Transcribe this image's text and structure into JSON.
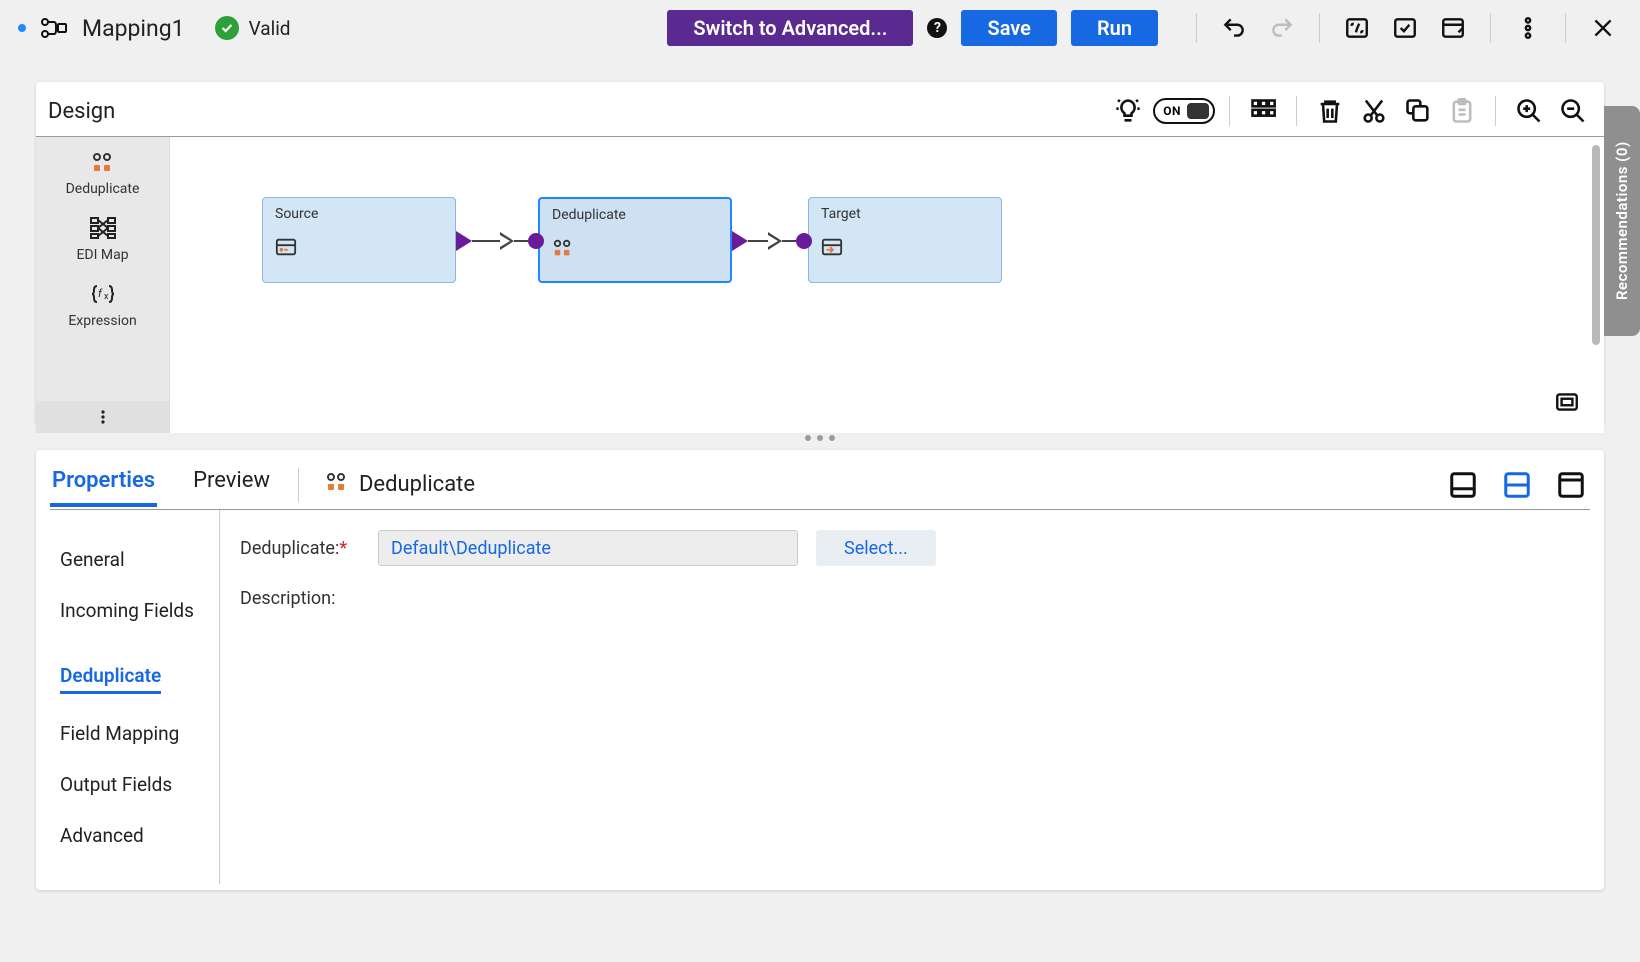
{
  "header": {
    "title": "Mapping1",
    "status_text": "Valid",
    "switch_label": "Switch to Advanced...",
    "save_label": "Save",
    "run_label": "Run"
  },
  "design": {
    "title": "Design",
    "toggle_label": "ON",
    "palette": [
      {
        "label": "Deduplicate",
        "icon": "dedup"
      },
      {
        "label": "EDI Map",
        "icon": "edimap"
      },
      {
        "label": "Expression",
        "icon": "expression"
      }
    ],
    "nodes": {
      "source": {
        "label": "Source"
      },
      "deduplicate": {
        "label": "Deduplicate"
      },
      "target": {
        "label": "Target"
      }
    }
  },
  "panel": {
    "tabs": {
      "properties": "Properties",
      "preview": "Preview"
    },
    "selected_tx": "Deduplicate",
    "sidetabs": {
      "general": "General",
      "incoming": "Incoming Fields",
      "deduplicate": "Deduplicate",
      "field_mapping": "Field Mapping",
      "output_fields": "Output Fields",
      "advanced": "Advanced"
    },
    "form": {
      "dedup_label": "Deduplicate:",
      "dedup_value": "Default\\Deduplicate",
      "select_label": "Select...",
      "description_label": "Description:"
    }
  },
  "recommendations_label": "Recommendations (0)"
}
